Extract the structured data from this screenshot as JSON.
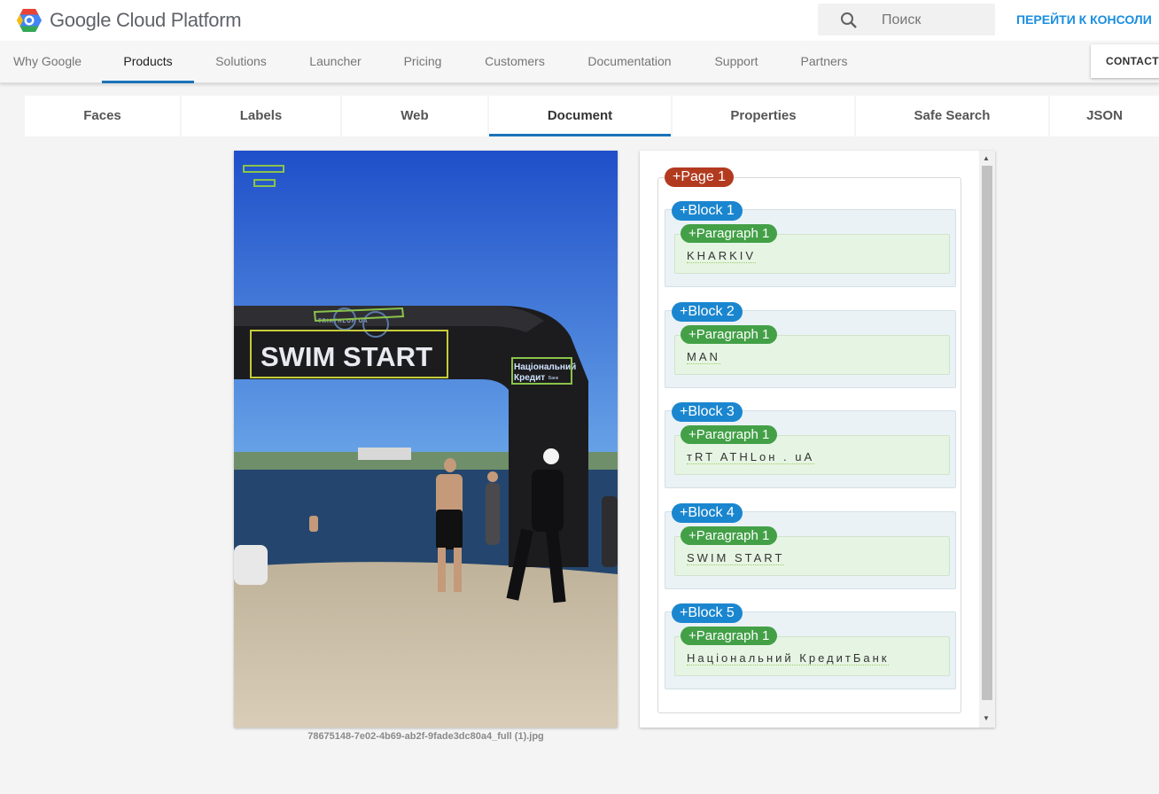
{
  "header": {
    "logo_text": "Google Cloud Platform",
    "search_placeholder": "Поиск",
    "console_link": "ПЕРЕЙТИ К КОНСОЛИ"
  },
  "nav": {
    "items": [
      "Why Google",
      "Products",
      "Solutions",
      "Launcher",
      "Pricing",
      "Customers",
      "Documentation",
      "Support",
      "Partners"
    ],
    "active": "Products",
    "contact_label": "CONTACT"
  },
  "tabs": {
    "items": [
      "Faces",
      "Labels",
      "Web",
      "Document",
      "Properties",
      "Safe Search",
      "JSON"
    ],
    "active": "Document"
  },
  "image": {
    "filename": "78675148-7e02-4b69-ab2f-9fade3dc80a4_full (1).jpg",
    "banner_text": "SWIM START",
    "sponsor_line1": "Національний",
    "sponsor_line2": "Кредит",
    "sponsor_small": "Банк",
    "logo_text": "TRIATHLON UA"
  },
  "results": {
    "page_label": "+Page 1",
    "blocks": [
      {
        "label": "+Block 1",
        "paragraph_label": "+Paragraph 1",
        "text": "KHARKIV"
      },
      {
        "label": "+Block 2",
        "paragraph_label": "+Paragraph 1",
        "text": "MAN"
      },
      {
        "label": "+Block 3",
        "paragraph_label": "+Paragraph 1",
        "text": "тRT ATHLон . uA"
      },
      {
        "label": "+Block 4",
        "paragraph_label": "+Paragraph 1",
        "text": "SWIM START"
      },
      {
        "label": "+Block 5",
        "paragraph_label": "+Paragraph 1",
        "text": "Національний КредитБанк"
      }
    ]
  },
  "colors": {
    "accent_blue": "#1a73b8",
    "link_blue": "#1a8ee0",
    "page_pill": "#b23a1f",
    "block_pill": "#1a86cf",
    "paragraph_pill": "#43a047",
    "ocr_box": "#8bc34a"
  }
}
